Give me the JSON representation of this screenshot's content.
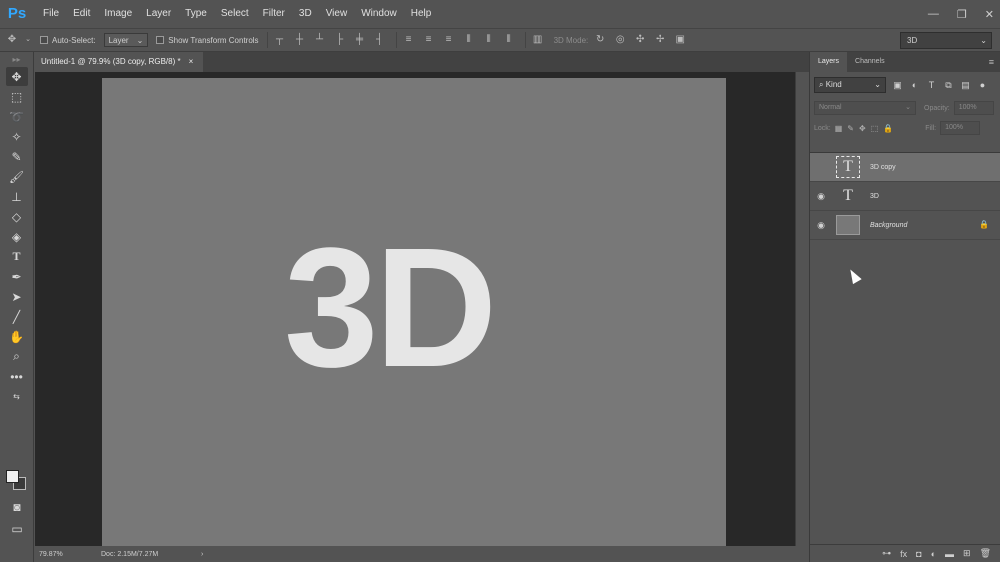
{
  "app": {
    "logo": "Ps"
  },
  "menu": [
    "File",
    "Edit",
    "Image",
    "Layer",
    "Type",
    "Select",
    "Filter",
    "3D",
    "View",
    "Window",
    "Help"
  ],
  "window_controls": {
    "minimize": "—",
    "restore": "❐",
    "close": "✕"
  },
  "options_bar": {
    "auto_select_label": "Auto-Select:",
    "auto_select_target": "Layer",
    "show_transform_label": "Show Transform Controls",
    "mode_3d_label": "3D Mode:",
    "workspace_select": "3D"
  },
  "document": {
    "tab_title": "Untitled-1 @ 79.9% (3D copy, RGB/8) *",
    "close_glyph": "×",
    "canvas_text": "3D"
  },
  "status_bar": {
    "zoom": "79.87%",
    "doc_size": "Doc: 2.15M/7.27M",
    "arrow": "›"
  },
  "layers_panel": {
    "tabs": [
      "Layers",
      "Channels"
    ],
    "filter_kind": "Kind",
    "blend_mode": "Normal",
    "opacity_label": "Opacity:",
    "opacity_value": "100%",
    "lock_label": "Lock:",
    "fill_label": "Fill:",
    "fill_value": "100%",
    "layers": [
      {
        "name": "3D copy",
        "type": "text",
        "visible": false,
        "selected": true
      },
      {
        "name": "3D",
        "type": "text",
        "visible": true,
        "selected": false
      },
      {
        "name": "Background",
        "type": "raster",
        "visible": true,
        "selected": false,
        "locked": true
      }
    ]
  },
  "colors": {
    "ui_bg": "#535353",
    "canvas_bg": "#787878",
    "workspace_bg": "#282828",
    "text_3d": "#e6e6e6",
    "ps_blue": "#31a8ff"
  }
}
